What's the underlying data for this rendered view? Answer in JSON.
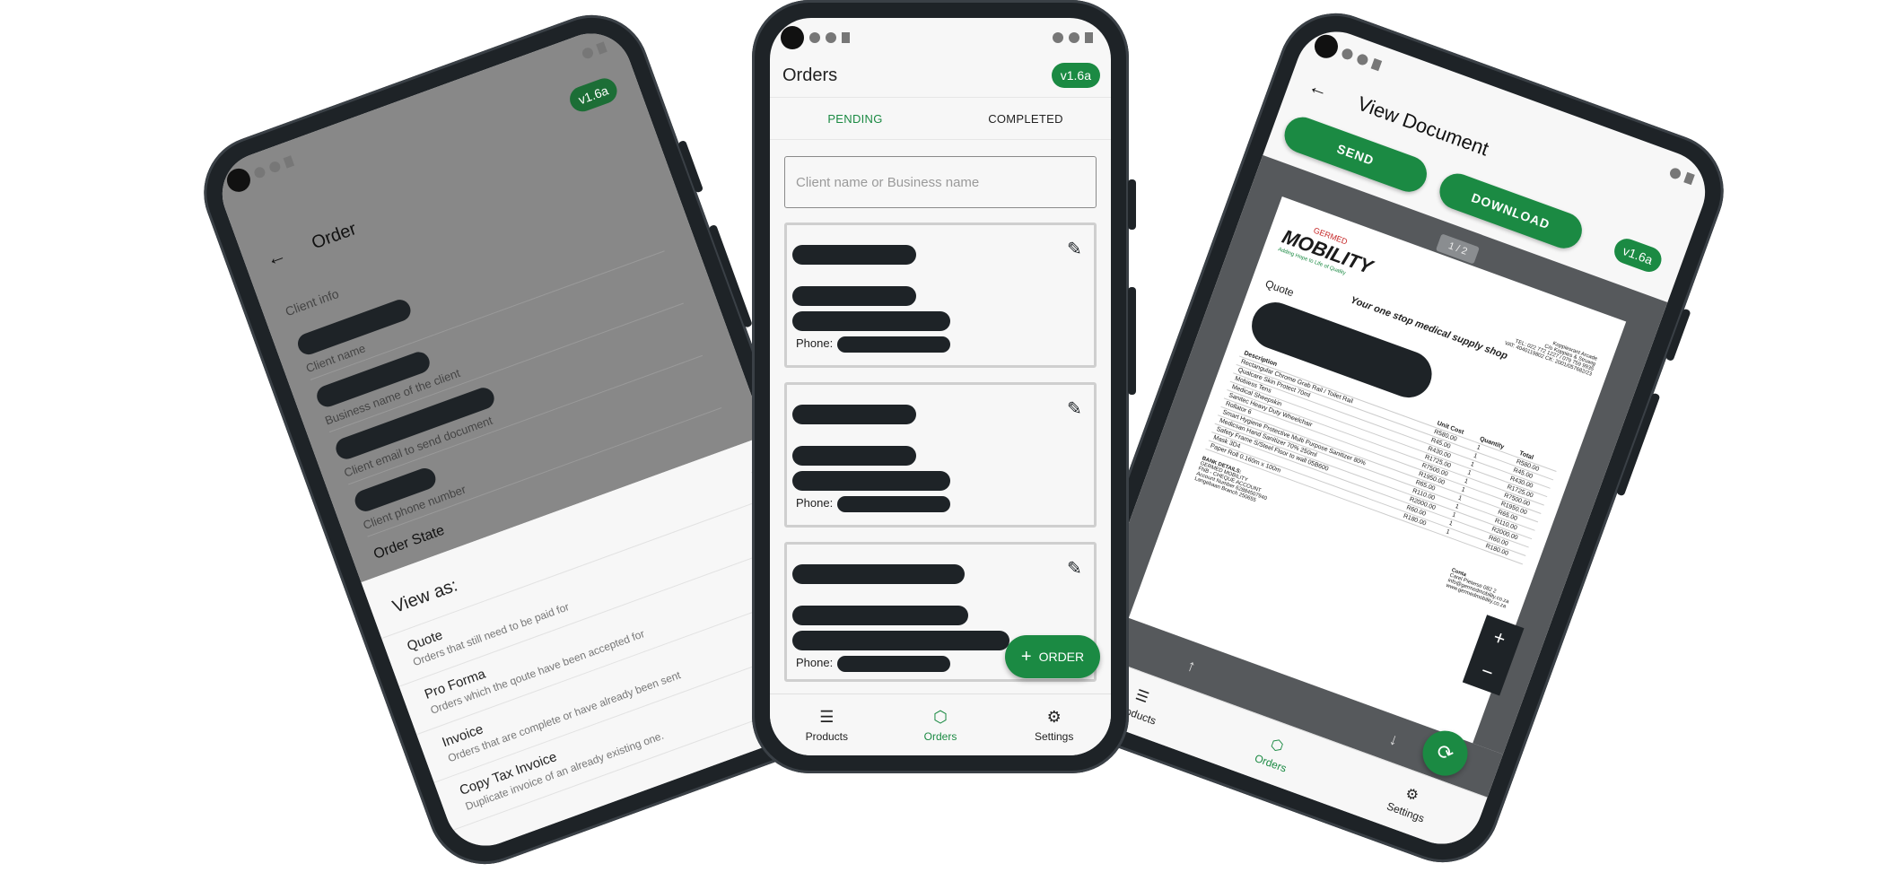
{
  "version_badge": "v1.6a",
  "left_phone": {
    "title": "Order",
    "section_client": "Client info",
    "fields": [
      {
        "hint": "Client name"
      },
      {
        "hint": "Business name of the client"
      },
      {
        "hint": "Client email to send document"
      },
      {
        "hint": "Client phone number"
      }
    ],
    "section_state": "Order State",
    "sheet_title": "View as:",
    "options": [
      {
        "title": "Quote",
        "desc": "Orders that still need to be paid for"
      },
      {
        "title": "Pro Forma",
        "desc": "Orders which the qoute have been accepted for"
      },
      {
        "title": "Invoice",
        "desc": "Orders that are complete or have already been sent"
      },
      {
        "title": "Copy Tax Invoice",
        "desc": "Duplicate invoice of an already existing one."
      }
    ]
  },
  "center_phone": {
    "title": "Orders",
    "tabs": [
      {
        "label": "PENDING",
        "active": true
      },
      {
        "label": "COMPLETED",
        "active": false
      }
    ],
    "search": {
      "placeholder": "Client name or Business name"
    },
    "cards": [
      {
        "phone_label": "Phone:"
      },
      {
        "phone_label": "Phone:"
      },
      {
        "phone_label": "Phone:"
      }
    ],
    "fab_label": "ORDER",
    "fab_icon": "plus-icon",
    "bottom_nav": [
      {
        "label": "Products",
        "icon": "list-icon",
        "active": false
      },
      {
        "label": "Orders",
        "icon": "box-icon",
        "active": true
      },
      {
        "label": "Settings",
        "icon": "gear-icon",
        "active": false
      }
    ]
  },
  "right_phone": {
    "title": "View Document",
    "send_label": "SEND",
    "download_label": "DOWNLOAD",
    "page_indicator": "1 / 2",
    "doc": {
      "brand_top": "GERMED",
      "brand_main": "MOBILITY",
      "brand_tag": "Adding Hope to Life of Quality",
      "tagline": "Your one stop medical supply shop",
      "doc_type": "Quote",
      "address_lines": [
        "Koppiesrant Arcade",
        "C/o Koppies & Struwig",
        "TEL: 022 772 1227 / 079 759 9935",
        "VAT: 4040119802  CK: 2001/057682/23"
      ],
      "columns": [
        "Description",
        "Unit Cost",
        "Quantity",
        "Total"
      ],
      "items": [
        [
          "Rectangular Chrome Grab Rail / Toilet Rail",
          "R580.00",
          "1",
          "R580.00"
        ],
        [
          "Qualcare Skin Protect 70ml",
          "R45.00",
          "1",
          "R45.00"
        ],
        [
          "Mobiess Tens",
          "R430.00",
          "1",
          "R430.00"
        ],
        [
          "Medical Sheepskin",
          "R1725.00",
          "1",
          "R1725.00"
        ],
        [
          "Sanitec Heavy Duty Wheelchair",
          "R7500.00",
          "1",
          "R7500.00"
        ],
        [
          "Rollator 6",
          "R1950.00",
          "1",
          "R1950.00"
        ],
        [
          "Smart Hygiene Protective Multi Purpose Sanitizer 80%",
          "R65.00",
          "1",
          "R65.00"
        ],
        [
          "Medicsan Hand Sanitizer 70% 250ml",
          "R110.00",
          "1",
          "R110.00"
        ],
        [
          "Safety Frame S/Steel Floor to wall 05B600",
          "R2000.00",
          "1",
          "R2000.00"
        ],
        [
          "Mask 3D4",
          "R60.00",
          "1",
          "R60.00"
        ],
        [
          "Paper Roll 0.160m x 100m",
          "R180.00",
          "1",
          "R180.00"
        ]
      ],
      "bank_title": "BANK DETAILS:",
      "bank_lines": [
        "GERMED MOBILITY",
        "FNB - CHEQUE ACCOUNT",
        "Account Number 62884507940",
        "Langebaan Branch 250655"
      ],
      "contact_lines": [
        "Carel Pieterse 082 2",
        "info@germedmobility.co.za",
        "www.germedmobility.co.za"
      ],
      "contact_title": "Conta"
    },
    "zoom_in": "+",
    "zoom_out": "−",
    "bottom_nav": [
      {
        "label": "Products",
        "icon": "list-icon",
        "active": false
      },
      {
        "label": "Orders",
        "icon": "box-icon",
        "active": true
      },
      {
        "label": "Settings",
        "icon": "gear-icon",
        "active": false
      }
    ]
  }
}
